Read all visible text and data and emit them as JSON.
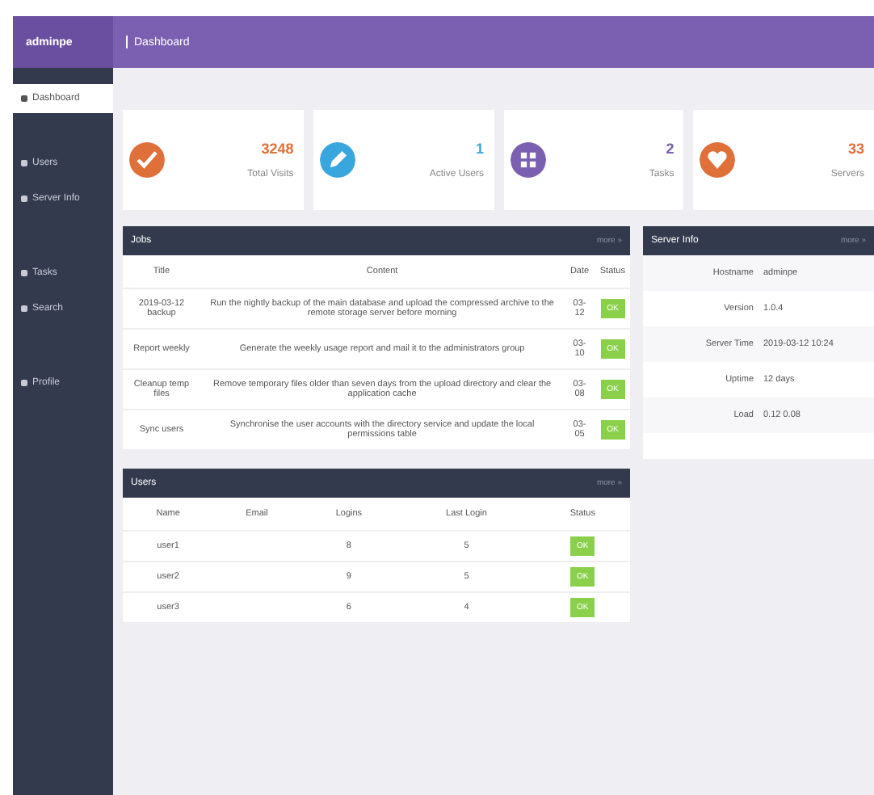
{
  "sidebar": {
    "brand": "adminpe",
    "items": [
      {
        "label": "Dashboard",
        "selected": true
      },
      {
        "label": "Users",
        "selected": false
      },
      {
        "label": "Server Info",
        "selected": false
      },
      {
        "label": "Tasks",
        "selected": false
      },
      {
        "label": "Search",
        "selected": false
      },
      {
        "label": "Profile",
        "selected": false
      }
    ]
  },
  "topbar": {
    "title": "Dashboard"
  },
  "stats": [
    {
      "value": "3248",
      "label": "Total Visits",
      "color": "#e0703a"
    },
    {
      "value": "1",
      "label": "Active Users",
      "color": "#3aa6de"
    },
    {
      "value": "2",
      "label": "Tasks",
      "color": "#7b5fb0"
    },
    {
      "value": "33",
      "label": "Servers",
      "color": "#e0703a"
    }
  ],
  "jobs": {
    "title": "Jobs",
    "action": "more »",
    "columns": [
      "Title",
      "Content",
      "Date",
      "Status"
    ],
    "rows": [
      {
        "title": "2019-03-12 backup",
        "content": "Run the nightly backup of the main database and upload the compressed archive to the remote storage server before morning",
        "date": "03-12",
        "status": "OK"
      },
      {
        "title": "Report weekly",
        "content": "Generate the weekly usage report and mail it to the administrators group",
        "date": "03-10",
        "status": "OK"
      },
      {
        "title": "Cleanup temp files",
        "content": "Remove temporary files older than seven days from the upload directory and clear the application cache",
        "date": "03-08",
        "status": "OK"
      },
      {
        "title": "Sync users",
        "content": "Synchronise the user accounts with the directory service and update the local permissions table",
        "date": "03-05",
        "status": "OK"
      }
    ]
  },
  "users": {
    "title": "Users",
    "action": "more »",
    "columns": [
      "Name",
      "Email",
      "Logins",
      "Last Login",
      "Status"
    ],
    "rows": [
      {
        "cells": [
          "user1",
          "",
          "8",
          "5"
        ],
        "status": "OK"
      },
      {
        "cells": [
          "user2",
          "",
          "9",
          "5"
        ],
        "status": "OK"
      },
      {
        "cells": [
          "user3",
          "",
          "6",
          "4"
        ],
        "status": "OK"
      }
    ]
  },
  "server": {
    "title": "Server Info",
    "action": "more »",
    "rows": [
      {
        "label": "Hostname",
        "value": "adminpe"
      },
      {
        "label": "Version",
        "value": "1.0.4"
      },
      {
        "label": "Server Time",
        "value": "2019-03-12 10:24"
      },
      {
        "label": "Uptime",
        "value": "12 days"
      },
      {
        "label": "Load",
        "value": "0.12 0.08"
      }
    ]
  }
}
